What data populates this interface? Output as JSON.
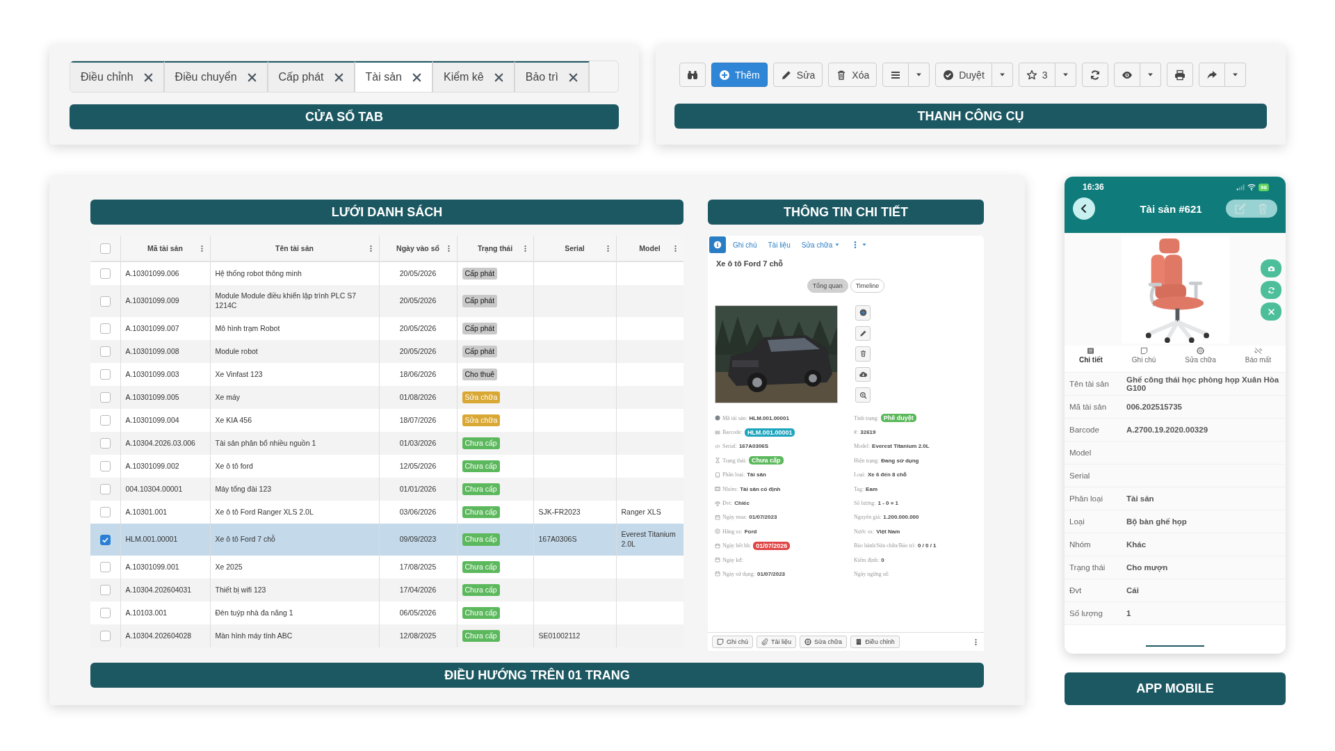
{
  "tab_window": {
    "tabs": [
      {
        "label": "Điều chỉnh",
        "selected": false
      },
      {
        "label": "Điều chuyển",
        "selected": false
      },
      {
        "label": "Cấp phát",
        "selected": false
      },
      {
        "label": "Tài sản",
        "selected": true
      },
      {
        "label": "Kiểm kê",
        "selected": false
      },
      {
        "label": "Bảo trì",
        "selected": false
      }
    ],
    "caption": "CỬA SỔ TAB"
  },
  "toolbar": {
    "buttons": [
      {
        "primary": false,
        "dropdown": false
      },
      {
        "label": "Thêm",
        "primary": true,
        "dropdown": false
      },
      {
        "label": "Sửa",
        "primary": false,
        "dropdown": false
      },
      {
        "label": "Xóa",
        "primary": false,
        "dropdown": false
      },
      {
        "primary": false,
        "dropdown": true
      },
      {
        "label": "Duyệt",
        "primary": false,
        "dropdown": true
      },
      {
        "label": "3",
        "primary": false,
        "dropdown": true
      },
      {
        "primary": false,
        "dropdown": false
      },
      {
        "primary": false,
        "dropdown": true
      },
      {
        "primary": false,
        "dropdown": false
      },
      {
        "primary": false,
        "dropdown": true
      }
    ],
    "caption": "THANH CÔNG CỤ"
  },
  "list_grid": {
    "caption": "LƯỚI DANH SÁCH",
    "all_checked": false,
    "columns": [
      "Mã tài sản",
      "Tên tài sản",
      "Ngày vào sổ",
      "Trạng thái",
      "Serial",
      "Model"
    ],
    "rows": [
      {
        "checked": false,
        "selected": false,
        "code": "A.10301099.006",
        "name": "Hệ thống robot thông minh",
        "date": "20/05/2026",
        "status": {
          "label": "Cấp phát",
          "color": "#c9c9c9"
        }
      },
      {
        "checked": false,
        "selected": false,
        "code": "A.10301099.009",
        "name": "Module Module điều khiển lập trình PLC S7 1214C",
        "date": "20/05/2026",
        "status": {
          "label": "Cấp phát",
          "color": "#c9c9c9"
        }
      },
      {
        "checked": false,
        "selected": false,
        "code": "A.10301099.007",
        "name": "Mô hình trạm Robot",
        "date": "20/05/2026",
        "status": {
          "label": "Cấp phát",
          "color": "#c9c9c9"
        }
      },
      {
        "checked": false,
        "selected": false,
        "code": "A.10301099.008",
        "name": "Module robot",
        "date": "20/05/2026",
        "status": {
          "label": "Cấp phát",
          "color": "#c9c9c9"
        }
      },
      {
        "checked": false,
        "selected": false,
        "code": "A.10301099.003",
        "name": "Xe Vinfast 123",
        "date": "18/06/2026",
        "status": {
          "label": "Cho thuê",
          "color": "#c9c9c9"
        }
      },
      {
        "checked": false,
        "selected": false,
        "code": "A.10301099.005",
        "name": "Xe máy",
        "date": "01/08/2026",
        "status": {
          "label": "Sửa chữa",
          "color": "#d9a834"
        }
      },
      {
        "checked": false,
        "selected": false,
        "code": "A.10301099.004",
        "name": "Xe KIA 456",
        "date": "18/07/2026",
        "status": {
          "label": "Sửa chữa",
          "color": "#d9a834"
        }
      },
      {
        "checked": false,
        "selected": false,
        "code": "A.10304.2026.03.006",
        "name": "Tài sản phân bổ nhiều nguồn 1",
        "date": "01/03/2026",
        "status": {
          "label": "Chưa cấp",
          "color": "#5cb85c"
        }
      },
      {
        "checked": false,
        "selected": false,
        "code": "A.10301099.002",
        "name": "Xe ô tô ford",
        "date": "12/05/2026",
        "status": {
          "label": "Chưa cấp",
          "color": "#5cb85c"
        }
      },
      {
        "checked": false,
        "selected": false,
        "code": "004.10304.00001",
        "name": "Máy tổng đài 123",
        "date": "01/01/2026",
        "status": {
          "label": "Chưa cấp",
          "color": "#5cb85c"
        }
      },
      {
        "checked": false,
        "selected": false,
        "code": "A.10301.001",
        "name": "Xe ô tô Ford Ranger XLS 2.0L",
        "date": "03/06/2026",
        "status": {
          "label": "Chưa cấp",
          "color": "#5cb85c"
        },
        "serial": "SJK-FR2023",
        "model": "Ranger XLS"
      },
      {
        "checked": true,
        "selected": true,
        "code": "HLM.001.00001",
        "name": "Xe ô tô Ford 7 chỗ",
        "date": "09/09/2023",
        "status": {
          "label": "Chưa cấp",
          "color": "#5cb85c"
        },
        "serial": "167A0306S",
        "model": "Everest Titanium 2.0L"
      },
      {
        "checked": false,
        "selected": false,
        "code": "A.10301099.001",
        "name": "Xe 2025",
        "date": "17/08/2025",
        "status": {
          "label": "Chưa cấp",
          "color": "#5cb85c"
        }
      },
      {
        "checked": false,
        "selected": false,
        "code": "A.10304.202604031",
        "name": "Thiết bị wifi 123",
        "date": "17/04/2026",
        "status": {
          "label": "Chưa cấp",
          "color": "#5cb85c"
        }
      },
      {
        "checked": false,
        "selected": false,
        "code": "A.10103.001",
        "name": "Đèn tuýp nhà đa năng 1",
        "date": "06/05/2026",
        "status": {
          "label": "Chưa cấp",
          "color": "#5cb85c"
        }
      },
      {
        "checked": false,
        "selected": false,
        "code": "A.10304.202604028",
        "name": "Màn hình máy tính ABC",
        "date": "12/08/2025",
        "status": {
          "label": "Chưa cấp",
          "color": "#5cb85c"
        },
        "serial": "SE01002112"
      }
    ]
  },
  "detail": {
    "caption": "THÔNG TIN CHI TIẾT",
    "nav": [
      {
        "selected": true,
        "dropdown": false
      },
      {
        "label": "Ghi chú",
        "selected": false,
        "dropdown": false
      },
      {
        "label": "Tài liệu",
        "selected": false,
        "dropdown": false
      },
      {
        "label": "Sửa chữa",
        "selected": false,
        "dropdown": true
      },
      {
        "selected": false,
        "dropdown": true
      }
    ],
    "title": "Xe ô tô Ford 7 chỗ",
    "views": [
      {
        "label": "Tổng quan",
        "selected": true
      },
      {
        "label": "Timeline",
        "selected": false
      }
    ],
    "left_fields": [
      {
        "label": "Mã tài sản:",
        "value": "HLM.001.00001"
      },
      {
        "label": "Barcode:",
        "value": "HLM.001.00001",
        "color": "#1ea5be"
      },
      {
        "label": "Serial:",
        "value": "167A0306S"
      },
      {
        "label": "Trạng thái:",
        "value": "Chưa cấp",
        "color": "#5cb85c"
      },
      {
        "label": "Phân loại:",
        "value": "Tài sản"
      },
      {
        "label": "Nhóm:",
        "value": "Tài sản cố định"
      },
      {
        "label": "Đvt:",
        "value": "Chiếc"
      },
      {
        "label": "Ngày mua:",
        "value": "01/07/2023"
      },
      {
        "label": "Hãng sx:",
        "value": "Ford"
      },
      {
        "label": "Ngày hết bh:",
        "value": "01/07/2026",
        "color": "#e04444"
      },
      {
        "label": "Ngày kđ:"
      },
      {
        "label": "Ngày sử dụng:",
        "value": "01/07/2023"
      }
    ],
    "right_fields": [
      {
        "label": "Tình trạng:",
        "value": "Phê duyệt",
        "color": "#5cb85c"
      },
      {
        "label": "#:",
        "value": "32619"
      },
      {
        "label": "Model:",
        "value": "Everest Titanium 2.0L"
      },
      {
        "label": "Hiện trạng:",
        "value": "Đang sử dụng"
      },
      {
        "label": "Loại:",
        "value": "Xe 6 đến 8 chỗ"
      },
      {
        "label": "Tag:",
        "value": "Eam"
      },
      {
        "label": "Số lượng:",
        "value": "1 - 0 = 1"
      },
      {
        "label": "Nguyên giá:",
        "value": "1.200.000.000"
      },
      {
        "label": "Nước sx:",
        "value": "Việt Nam"
      },
      {
        "label": "Bảo hành/Sửa chữa/Bảo trì:",
        "value": "0 / 0 / 1"
      },
      {
        "label": "Kiểm định:",
        "value": "0"
      },
      {
        "label": "Ngày ngừng sd:"
      }
    ],
    "actions": [
      "Ghi chú",
      "Tài liệu",
      "Sửa chữa",
      "Điều chỉnh"
    ]
  },
  "navigation_caption": "ĐIỀU HƯỚNG TRÊN 01 TRANG",
  "mobile": {
    "time": "16:36",
    "battery": "98",
    "title": "Tài sản #621",
    "tabs": [
      {
        "label": "Chi tiết",
        "selected": true
      },
      {
        "label": "Ghi chú",
        "selected": false
      },
      {
        "label": "Sửa chữa",
        "selected": false
      },
      {
        "label": "Báo mất",
        "selected": false
      }
    ],
    "properties": [
      {
        "label": "Tên tài sản",
        "value": "Ghế công thái học phòng họp Xuân Hòa G100"
      },
      {
        "label": "Mã tài sản",
        "value": "006.202515735"
      },
      {
        "label": "Barcode",
        "value": "A.2700.19.2020.00329"
      },
      {
        "label": "Model"
      },
      {
        "label": "Serial"
      },
      {
        "label": "Phân loại",
        "value": "Tài sản"
      },
      {
        "label": "Loại",
        "value": "Bộ bàn ghế họp"
      },
      {
        "label": "Nhóm",
        "value": "Khác"
      },
      {
        "label": "Trạng thái",
        "value": "Cho mượn"
      },
      {
        "label": "Đvt",
        "value": "Cái"
      },
      {
        "label": "Số lượng",
        "value": "1"
      }
    ],
    "caption": "APP MOBILE"
  }
}
